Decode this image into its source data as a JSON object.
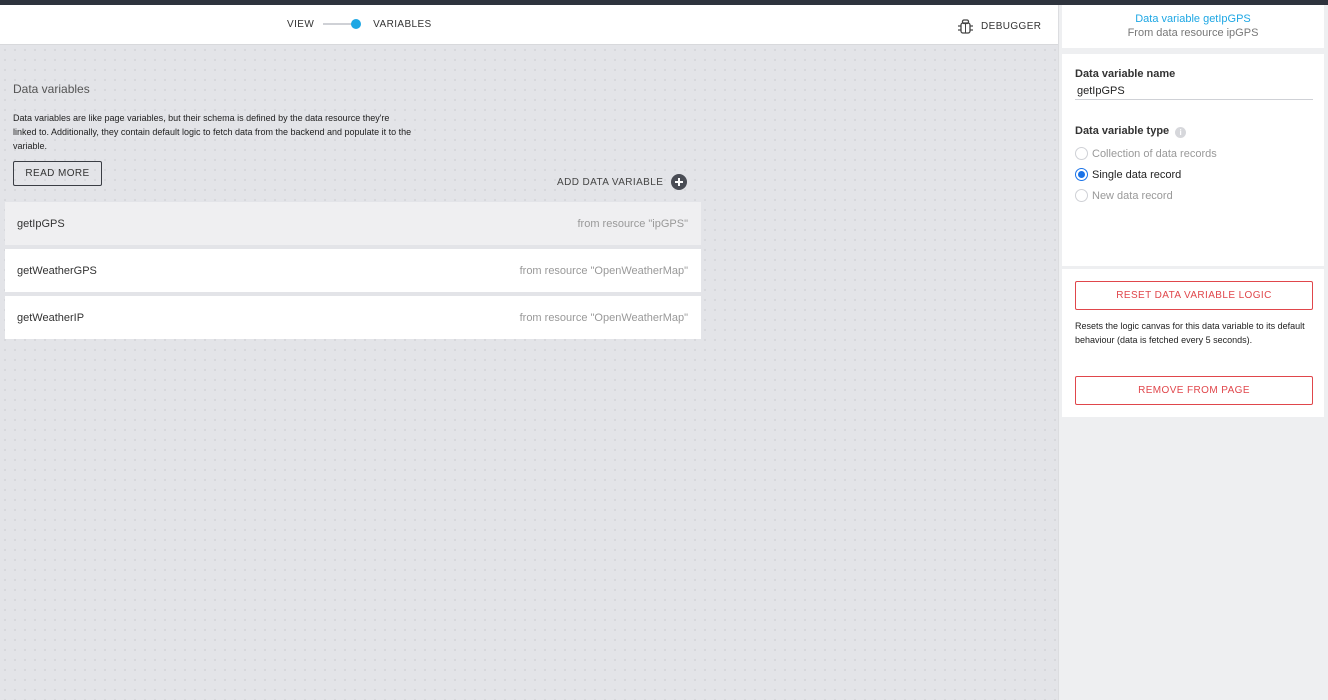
{
  "header": {
    "toggle": {
      "left_label": "VIEW",
      "right_label": "VARIABLES"
    },
    "debugger_label": "DEBUGGER",
    "accent_color": "#1ea7e4"
  },
  "main": {
    "section_title": "Data variables",
    "description": "Data variables are like page variables, but their schema is defined by the data resource they're linked to. Additionally, they contain default logic to fetch data from the backend and populate it to the variable.",
    "read_more_label": "READ MORE",
    "add_label": "ADD DATA VARIABLE",
    "variables": [
      {
        "name": "getIpGPS",
        "resource": "from resource \"ipGPS\"",
        "selected": true
      },
      {
        "name": "getWeatherGPS",
        "resource": "from resource \"OpenWeatherMap\"",
        "selected": false
      },
      {
        "name": "getWeatherIP",
        "resource": "from resource \"OpenWeatherMap\"",
        "selected": false
      }
    ]
  },
  "panel": {
    "title": "Data variable getIpGPS",
    "subtitle": "From data resource ipGPS",
    "name_label": "Data variable name",
    "name_value": "getIpGPS",
    "type_label": "Data variable type",
    "type_options": [
      {
        "label": "Collection of data records",
        "selected": false
      },
      {
        "label": "Single data record",
        "selected": true
      },
      {
        "label": "New data record",
        "selected": false
      }
    ],
    "reset_label": "RESET DATA VARIABLE LOGIC",
    "reset_description": "Resets the logic canvas for this data variable to its default behaviour (data is fetched every 5 seconds).",
    "remove_label": "REMOVE FROM PAGE",
    "danger_color": "#e0464b"
  }
}
